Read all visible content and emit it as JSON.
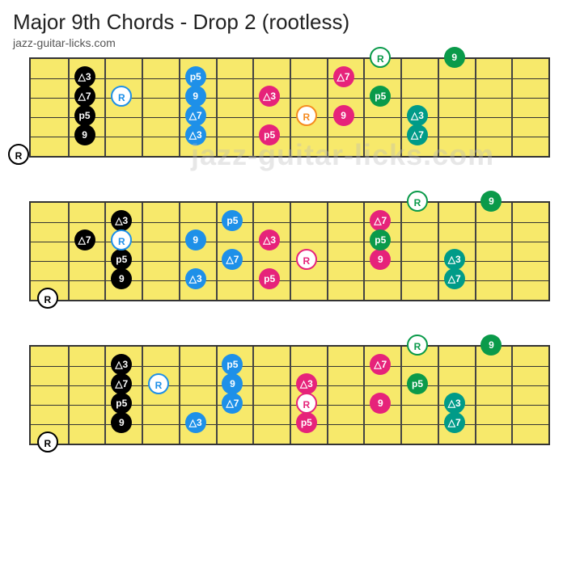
{
  "title": "Major 9th Chords - Drop 2 (rootless)",
  "subtitle": "jazz-guitar-licks.com",
  "watermark": "jazz-guitar-licks.com",
  "frets_per_diagram": 14,
  "strings": 6,
  "labels": {
    "R": "R",
    "M3": "△3",
    "M7": "△7",
    "P5": "p5",
    "N9": "9"
  },
  "colors": {
    "black": "#000000",
    "blue": "#1e90e8",
    "teal": "#009b88",
    "green": "#0a9a4a",
    "pink": "#e6237a",
    "orange": "#f58b1f"
  },
  "diagrams": [
    {
      "notes": [
        {
          "string": 6,
          "fret": 0,
          "label": "R",
          "style": "hollow",
          "color": "black"
        },
        {
          "string": 2,
          "fret": 2,
          "label": "M3",
          "style": "solid",
          "color": "black"
        },
        {
          "string": 3,
          "fret": 2,
          "label": "M7",
          "style": "solid",
          "color": "black"
        },
        {
          "string": 4,
          "fret": 2,
          "label": "P5",
          "style": "solid",
          "color": "black"
        },
        {
          "string": 5,
          "fret": 2,
          "label": "N9",
          "style": "solid",
          "color": "black"
        },
        {
          "string": 3,
          "fret": 3,
          "label": "R",
          "style": "hollow",
          "color": "blue"
        },
        {
          "string": 2,
          "fret": 5,
          "label": "P5",
          "style": "solid",
          "color": "blue"
        },
        {
          "string": 3,
          "fret": 5,
          "label": "N9",
          "style": "solid",
          "color": "blue"
        },
        {
          "string": 4,
          "fret": 5,
          "label": "M7",
          "style": "solid",
          "color": "blue"
        },
        {
          "string": 5,
          "fret": 5,
          "label": "M3",
          "style": "solid",
          "color": "blue"
        },
        {
          "string": 3,
          "fret": 7,
          "label": "M3",
          "style": "solid",
          "color": "pink"
        },
        {
          "string": 5,
          "fret": 7,
          "label": "P5",
          "style": "solid",
          "color": "pink"
        },
        {
          "string": 4,
          "fret": 8,
          "label": "R",
          "style": "hollow",
          "color": "orange"
        },
        {
          "string": 2,
          "fret": 9,
          "label": "M7",
          "style": "solid",
          "color": "pink"
        },
        {
          "string": 4,
          "fret": 9,
          "label": "N9",
          "style": "solid",
          "color": "pink"
        },
        {
          "string": 1,
          "fret": 10,
          "label": "R",
          "style": "hollow",
          "color": "green"
        },
        {
          "string": 3,
          "fret": 10,
          "label": "P5",
          "style": "solid",
          "color": "green"
        },
        {
          "string": 4,
          "fret": 11,
          "label": "M3",
          "style": "solid",
          "color": "teal"
        },
        {
          "string": 5,
          "fret": 11,
          "label": "M7",
          "style": "solid",
          "color": "teal"
        },
        {
          "string": 1,
          "fret": 12,
          "label": "N9",
          "style": "solid",
          "color": "green"
        }
      ]
    },
    {
      "notes": [
        {
          "string": 6,
          "fret": 1,
          "label": "R",
          "style": "hollow",
          "color": "black"
        },
        {
          "string": 3,
          "fret": 2,
          "label": "M7",
          "style": "solid",
          "color": "black"
        },
        {
          "string": 2,
          "fret": 3,
          "label": "M3",
          "style": "solid",
          "color": "black"
        },
        {
          "string": 4,
          "fret": 3,
          "label": "P5",
          "style": "solid",
          "color": "black"
        },
        {
          "string": 5,
          "fret": 3,
          "label": "N9",
          "style": "solid",
          "color": "black"
        },
        {
          "string": 3,
          "fret": 3,
          "label": "R",
          "style": "hollow",
          "color": "blue"
        },
        {
          "string": 3,
          "fret": 5,
          "label": "N9",
          "style": "solid",
          "color": "blue"
        },
        {
          "string": 5,
          "fret": 5,
          "label": "M3",
          "style": "solid",
          "color": "blue"
        },
        {
          "string": 2,
          "fret": 6,
          "label": "P5",
          "style": "solid",
          "color": "blue"
        },
        {
          "string": 4,
          "fret": 6,
          "label": "M7",
          "style": "solid",
          "color": "blue"
        },
        {
          "string": 3,
          "fret": 7,
          "label": "M3",
          "style": "solid",
          "color": "pink"
        },
        {
          "string": 5,
          "fret": 7,
          "label": "P5",
          "style": "solid",
          "color": "pink"
        },
        {
          "string": 4,
          "fret": 8,
          "label": "R",
          "style": "hollow",
          "color": "pink"
        },
        {
          "string": 4,
          "fret": 10,
          "label": "N9",
          "style": "solid",
          "color": "pink"
        },
        {
          "string": 2,
          "fret": 10,
          "label": "M7",
          "style": "solid",
          "color": "pink"
        },
        {
          "string": 3,
          "fret": 10,
          "label": "P5",
          "style": "solid",
          "color": "green"
        },
        {
          "string": 1,
          "fret": 11,
          "label": "R",
          "style": "hollow",
          "color": "green"
        },
        {
          "string": 4,
          "fret": 12,
          "label": "M3",
          "style": "solid",
          "color": "teal"
        },
        {
          "string": 5,
          "fret": 12,
          "label": "M7",
          "style": "solid",
          "color": "teal"
        },
        {
          "string": 1,
          "fret": 13,
          "label": "N9",
          "style": "solid",
          "color": "green"
        }
      ]
    },
    {
      "notes": [
        {
          "string": 6,
          "fret": 1,
          "label": "R",
          "style": "hollow",
          "color": "black"
        },
        {
          "string": 2,
          "fret": 3,
          "label": "M3",
          "style": "solid",
          "color": "black"
        },
        {
          "string": 3,
          "fret": 3,
          "label": "M7",
          "style": "solid",
          "color": "black"
        },
        {
          "string": 4,
          "fret": 3,
          "label": "P5",
          "style": "solid",
          "color": "black"
        },
        {
          "string": 5,
          "fret": 3,
          "label": "N9",
          "style": "solid",
          "color": "black"
        },
        {
          "string": 3,
          "fret": 4,
          "label": "R",
          "style": "hollow",
          "color": "blue"
        },
        {
          "string": 5,
          "fret": 5,
          "label": "M3",
          "style": "solid",
          "color": "blue"
        },
        {
          "string": 2,
          "fret": 6,
          "label": "P5",
          "style": "solid",
          "color": "blue"
        },
        {
          "string": 3,
          "fret": 6,
          "label": "N9",
          "style": "solid",
          "color": "blue"
        },
        {
          "string": 4,
          "fret": 6,
          "label": "M7",
          "style": "solid",
          "color": "blue"
        },
        {
          "string": 5,
          "fret": 8,
          "label": "P5",
          "style": "solid",
          "color": "pink"
        },
        {
          "string": 3,
          "fret": 8,
          "label": "M3",
          "style": "solid",
          "color": "pink"
        },
        {
          "string": 4,
          "fret": 8,
          "label": "R",
          "style": "hollow",
          "color": "pink"
        },
        {
          "string": 4,
          "fret": 10,
          "label": "N9",
          "style": "solid",
          "color": "pink"
        },
        {
          "string": 2,
          "fret": 10,
          "label": "M7",
          "style": "solid",
          "color": "pink"
        },
        {
          "string": 3,
          "fret": 11,
          "label": "P5",
          "style": "solid",
          "color": "green"
        },
        {
          "string": 1,
          "fret": 11,
          "label": "R",
          "style": "hollow",
          "color": "green"
        },
        {
          "string": 4,
          "fret": 12,
          "label": "M3",
          "style": "solid",
          "color": "teal"
        },
        {
          "string": 5,
          "fret": 12,
          "label": "M7",
          "style": "solid",
          "color": "teal"
        },
        {
          "string": 1,
          "fret": 13,
          "label": "N9",
          "style": "solid",
          "color": "green"
        }
      ]
    }
  ],
  "chart_data": {
    "type": "table",
    "description": "Guitar fretboard diagrams showing Major 9th chord tones (Root, 3, 5, 7, 9) as Drop 2 rootless voicings across three string sets.",
    "string_count": 6,
    "fret_count": 14,
    "intervals": [
      "R",
      "3",
      "5",
      "7",
      "9"
    ]
  }
}
